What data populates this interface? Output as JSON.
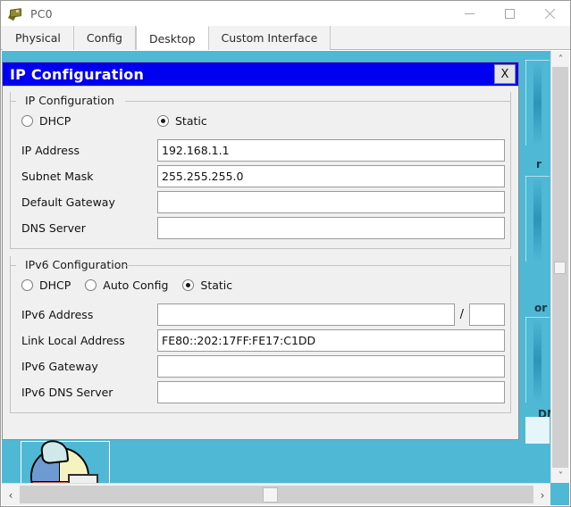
{
  "window": {
    "title": "PC0",
    "icon": "device-icon",
    "controls": {
      "minimize": "–",
      "maximize": "□",
      "close": "✕"
    }
  },
  "tabs": [
    {
      "label": "Physical",
      "active": false
    },
    {
      "label": "Config",
      "active": false
    },
    {
      "label": "Desktop",
      "active": true
    },
    {
      "label": "Custom Interface",
      "active": false
    }
  ],
  "dialog": {
    "title": "IP Configuration",
    "close_label": "X",
    "ipv4": {
      "group_label": "IP Configuration",
      "modes": [
        {
          "label": "DHCP",
          "selected": false
        },
        {
          "label": "Static",
          "selected": true
        }
      ],
      "fields": [
        {
          "label": "IP Address",
          "value": "192.168.1.1"
        },
        {
          "label": "Subnet Mask",
          "value": "255.255.255.0"
        },
        {
          "label": "Default Gateway",
          "value": ""
        },
        {
          "label": "DNS Server",
          "value": ""
        }
      ]
    },
    "ipv6": {
      "group_label": "IPv6 Configuration",
      "modes": [
        {
          "label": "DHCP",
          "selected": false
        },
        {
          "label": "Auto Config",
          "selected": false
        },
        {
          "label": "Static",
          "selected": true
        }
      ],
      "address_label": "IPv6 Address",
      "address_value": "",
      "prefix_separator": "/",
      "prefix_value": "",
      "fields": [
        {
          "label": "Link Local Address",
          "value": "FE80::202:17FF:FE17:C1DD"
        },
        {
          "label": "IPv6 Gateway",
          "value": ""
        },
        {
          "label": "IPv6 DNS Server",
          "value": ""
        }
      ]
    }
  },
  "desktop": {
    "background_color": "#4fb8d5",
    "partial_labels": [
      "r",
      "or",
      "DN"
    ]
  },
  "scrollbars": {
    "vertical": {
      "up": "˄",
      "down": "˅"
    },
    "horizontal": {
      "left": "‹",
      "right": "›"
    }
  }
}
